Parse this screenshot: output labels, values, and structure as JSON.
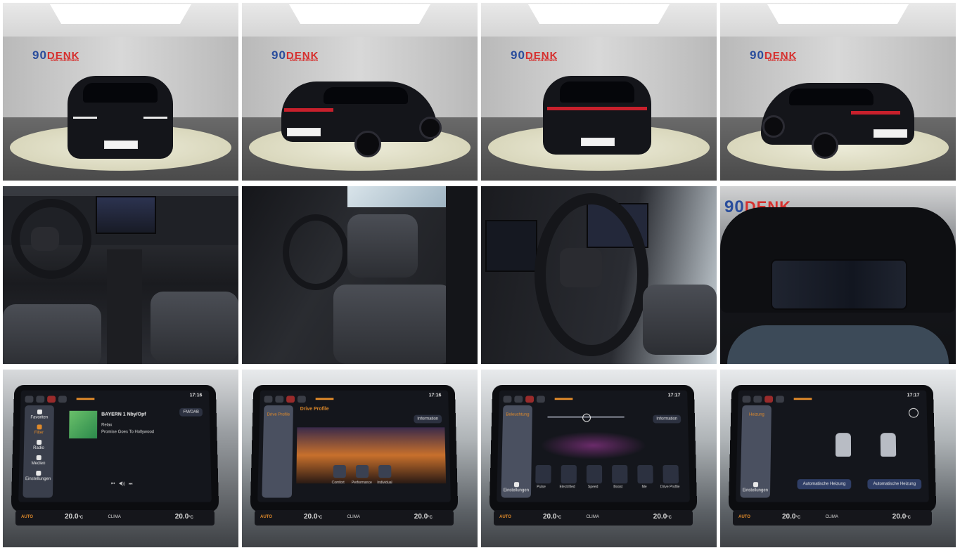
{
  "gallery": {
    "images": [
      {
        "name": "exterior-front"
      },
      {
        "name": "exterior-rear-left"
      },
      {
        "name": "exterior-rear"
      },
      {
        "name": "exterior-rear-right"
      },
      {
        "name": "interior-cockpit"
      },
      {
        "name": "interior-front-seats"
      },
      {
        "name": "interior-steering-wheel"
      },
      {
        "name": "digital-instrument-cluster"
      },
      {
        "name": "infotainment-radio"
      },
      {
        "name": "infotainment-drive-profile"
      },
      {
        "name": "infotainment-ambient-light"
      },
      {
        "name": "infotainment-seat-heating"
      }
    ]
  },
  "dealer": {
    "logo_number": "90",
    "logo_text": "DENK",
    "logo_sub": "Das Autohaus"
  },
  "infotainment": {
    "clock_radio": "17:16",
    "clock_drive": "17:16",
    "clock_light": "17:17",
    "clock_seat": "17:17",
    "climate": {
      "auto": "AUTO",
      "left_temp": "20.0",
      "right_temp": "20.0",
      "unit": "°C",
      "clima": "CLIMA"
    },
    "radio": {
      "sidebar": [
        "Favoriten",
        "Filter",
        "Radio",
        "Medien",
        "Einstellungen"
      ],
      "station": "BAYERN 1 Nby/Opf",
      "sub": "Relax",
      "track": "Promise Goes To Hollywood",
      "source": "FM/DAB"
    },
    "drive": {
      "sidebar": "Drive Profile",
      "title": "Drive Profile",
      "info": "Information",
      "modes": [
        "Comfort",
        "Performance",
        "Individual"
      ]
    },
    "light": {
      "sidebar": "Beleuchtung",
      "settings": "Einstellungen",
      "info": "Information",
      "modes": [
        "Pulse",
        "Electrified",
        "Speed",
        "Boost",
        "Me",
        "Drive Profile"
      ]
    },
    "seat": {
      "sidebar": "Heizung",
      "settings": "Einstellungen",
      "left_btn": "Automatische Heizung",
      "right_btn": "Automatische Heizung"
    }
  },
  "colors": {
    "accent": "#e08a2a",
    "brand_red": "#d6302e",
    "brand_blue": "#2a4d9c"
  }
}
